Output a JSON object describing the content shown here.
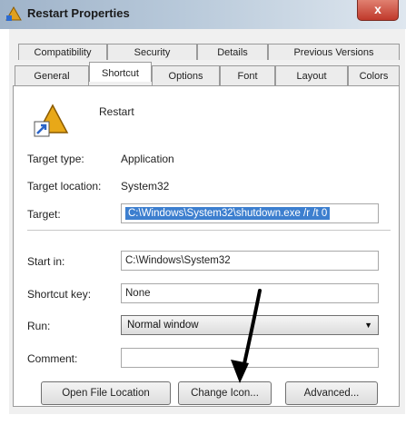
{
  "window": {
    "title": "Restart Properties",
    "close_label": "x"
  },
  "tabs_row1": [
    "Compatibility",
    "Security",
    "Details",
    "Previous Versions"
  ],
  "tabs_row2": [
    "General",
    "Shortcut",
    "Options",
    "Font",
    "Layout",
    "Colors"
  ],
  "shortcut": {
    "name": "Restart"
  },
  "fields": {
    "target_type_label": "Target type:",
    "target_type_value": "Application",
    "target_location_label": "Target location:",
    "target_location_value": "System32",
    "target_label": "Target:",
    "target_value": "C:\\Windows\\System32\\shutdown.exe /r /t 0",
    "start_in_label": "Start in:",
    "start_in_value": "C:\\Windows\\System32",
    "shortcut_key_label": "Shortcut key:",
    "shortcut_key_value": "None",
    "run_label": "Run:",
    "run_value": "Normal window",
    "comment_label": "Comment:",
    "comment_value": ""
  },
  "buttons": {
    "open_file_location": "Open File Location",
    "change_icon": "Change Icon...",
    "advanced": "Advanced..."
  }
}
